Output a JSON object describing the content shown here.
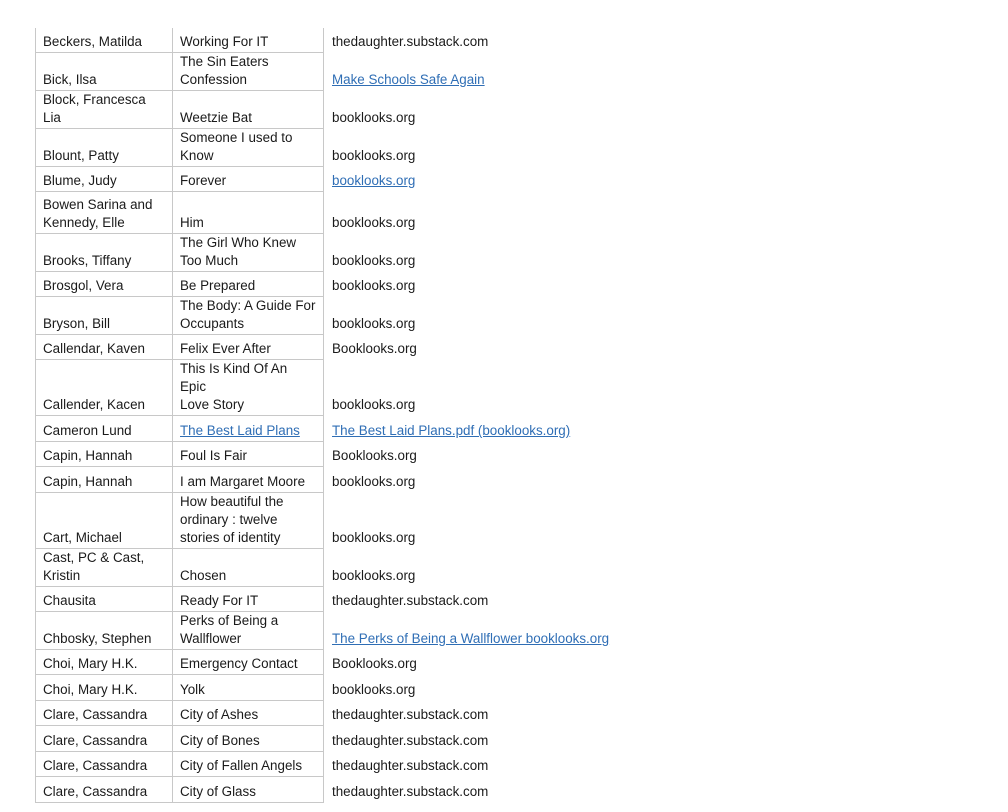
{
  "table": {
    "rows": [
      {
        "author": "Beckers, Matilda",
        "title": "Working For IT",
        "source": "thedaughter.substack.com",
        "title_link": false,
        "source_link": false
      },
      {
        "author": "Bick, Ilsa",
        "title": "The Sin Eaters\nConfession",
        "source": "Make Schools Safe Again",
        "title_link": false,
        "source_link": true
      },
      {
        "author": "Block, Francesca Lia",
        "title": "Weetzie Bat",
        "source": "booklooks.org",
        "title_link": false,
        "source_link": false
      },
      {
        "author": "Blount, Patty",
        "title": "Someone I used to\nKnow",
        "source": "booklooks.org",
        "title_link": false,
        "source_link": false
      },
      {
        "author": "Blume, Judy",
        "title": "Forever",
        "source": "booklooks.org",
        "title_link": false,
        "source_link": true
      },
      {
        "author": "Bowen Sarina and\nKennedy, Elle",
        "title": "Him",
        "source": "booklooks.org",
        "title_link": false,
        "source_link": false
      },
      {
        "author": "Brooks, Tiffany",
        "title": "The Girl Who Knew\nToo Much",
        "source": "booklooks.org",
        "title_link": false,
        "source_link": false
      },
      {
        "author": "Brosgol, Vera",
        "title": "Be Prepared",
        "source": "booklooks.org",
        "title_link": false,
        "source_link": false
      },
      {
        "author": "Bryson, Bill",
        "title": "The Body: A Guide For\nOccupants",
        "source": "booklooks.org",
        "title_link": false,
        "source_link": false
      },
      {
        "author": "Callendar, Kaven",
        "title": "Felix Ever After",
        "source": "Booklooks.org",
        "title_link": false,
        "source_link": false
      },
      {
        "author": "Callender, Kacen",
        "title": "This Is Kind Of An Epic\nLove Story",
        "source": "booklooks.org",
        "title_link": false,
        "source_link": false
      },
      {
        "author": "Cameron Lund",
        "title": "The Best Laid Plans",
        "source": "The Best Laid Plans.pdf (booklooks.org)",
        "title_link": true,
        "source_link": true
      },
      {
        "author": "Capin, Hannah",
        "title": "Foul Is Fair",
        "source": "Booklooks.org",
        "title_link": false,
        "source_link": false
      },
      {
        "author": "Capin, Hannah",
        "title": "I am Margaret Moore",
        "source": "booklooks.org",
        "title_link": false,
        "source_link": false
      },
      {
        "author": "Cart, Michael",
        "title": "How beautiful the\nordinary : twelve\nstories of identity",
        "source": "booklooks.org",
        "title_link": false,
        "source_link": false
      },
      {
        "author": "Cast, PC & Cast,\nKristin",
        "title": "Chosen",
        "source": "booklooks.org",
        "title_link": false,
        "source_link": false
      },
      {
        "author": "Chausita",
        "title": "Ready For IT",
        "source": "thedaughter.substack.com",
        "title_link": false,
        "source_link": false
      },
      {
        "author": "Chbosky, Stephen",
        "title": "Perks of Being a\nWallflower",
        "source": "The Perks of Being a Wallflower booklooks.org",
        "title_link": false,
        "source_link": true
      },
      {
        "author": "Choi, Mary H.K.",
        "title": "Emergency Contact",
        "source": "Booklooks.org",
        "title_link": false,
        "source_link": false
      },
      {
        "author": "Choi, Mary H.K.",
        "title": "Yolk",
        "source": "booklooks.org",
        "title_link": false,
        "source_link": false
      },
      {
        "author": "Clare, Cassandra",
        "title": "City of Ashes",
        "source": "thedaughter.substack.com",
        "title_link": false,
        "source_link": false
      },
      {
        "author": "Clare, Cassandra",
        "title": "City of Bones",
        "source": "thedaughter.substack.com",
        "title_link": false,
        "source_link": false
      },
      {
        "author": "Clare, Cassandra",
        "title": "City of Fallen Angels",
        "source": "thedaughter.substack.com",
        "title_link": false,
        "source_link": false
      },
      {
        "author": "Clare, Cassandra",
        "title": "City of Glass",
        "source": "thedaughter.substack.com",
        "title_link": false,
        "source_link": false
      }
    ]
  },
  "colors": {
    "link": "#2f6eb5",
    "text": "#1a1a1a",
    "border": "#c8c8c8"
  }
}
